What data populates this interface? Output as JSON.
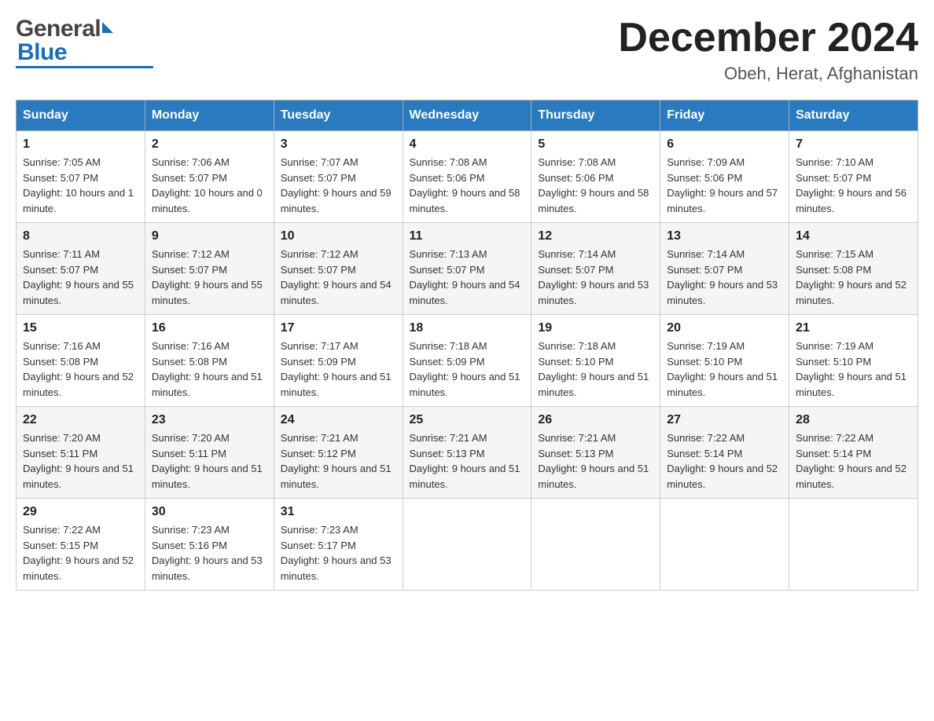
{
  "header": {
    "logo_general": "General",
    "logo_blue": "Blue",
    "month_title": "December 2024",
    "location": "Obeh, Herat, Afghanistan"
  },
  "calendar": {
    "days_of_week": [
      "Sunday",
      "Monday",
      "Tuesday",
      "Wednesday",
      "Thursday",
      "Friday",
      "Saturday"
    ],
    "weeks": [
      [
        {
          "day": "1",
          "sunrise": "7:05 AM",
          "sunset": "5:07 PM",
          "daylight": "10 hours and 1 minute."
        },
        {
          "day": "2",
          "sunrise": "7:06 AM",
          "sunset": "5:07 PM",
          "daylight": "10 hours and 0 minutes."
        },
        {
          "day": "3",
          "sunrise": "7:07 AM",
          "sunset": "5:07 PM",
          "daylight": "9 hours and 59 minutes."
        },
        {
          "day": "4",
          "sunrise": "7:08 AM",
          "sunset": "5:06 PM",
          "daylight": "9 hours and 58 minutes."
        },
        {
          "day": "5",
          "sunrise": "7:08 AM",
          "sunset": "5:06 PM",
          "daylight": "9 hours and 58 minutes."
        },
        {
          "day": "6",
          "sunrise": "7:09 AM",
          "sunset": "5:06 PM",
          "daylight": "9 hours and 57 minutes."
        },
        {
          "day": "7",
          "sunrise": "7:10 AM",
          "sunset": "5:07 PM",
          "daylight": "9 hours and 56 minutes."
        }
      ],
      [
        {
          "day": "8",
          "sunrise": "7:11 AM",
          "sunset": "5:07 PM",
          "daylight": "9 hours and 55 minutes."
        },
        {
          "day": "9",
          "sunrise": "7:12 AM",
          "sunset": "5:07 PM",
          "daylight": "9 hours and 55 minutes."
        },
        {
          "day": "10",
          "sunrise": "7:12 AM",
          "sunset": "5:07 PM",
          "daylight": "9 hours and 54 minutes."
        },
        {
          "day": "11",
          "sunrise": "7:13 AM",
          "sunset": "5:07 PM",
          "daylight": "9 hours and 54 minutes."
        },
        {
          "day": "12",
          "sunrise": "7:14 AM",
          "sunset": "5:07 PM",
          "daylight": "9 hours and 53 minutes."
        },
        {
          "day": "13",
          "sunrise": "7:14 AM",
          "sunset": "5:07 PM",
          "daylight": "9 hours and 53 minutes."
        },
        {
          "day": "14",
          "sunrise": "7:15 AM",
          "sunset": "5:08 PM",
          "daylight": "9 hours and 52 minutes."
        }
      ],
      [
        {
          "day": "15",
          "sunrise": "7:16 AM",
          "sunset": "5:08 PM",
          "daylight": "9 hours and 52 minutes."
        },
        {
          "day": "16",
          "sunrise": "7:16 AM",
          "sunset": "5:08 PM",
          "daylight": "9 hours and 51 minutes."
        },
        {
          "day": "17",
          "sunrise": "7:17 AM",
          "sunset": "5:09 PM",
          "daylight": "9 hours and 51 minutes."
        },
        {
          "day": "18",
          "sunrise": "7:18 AM",
          "sunset": "5:09 PM",
          "daylight": "9 hours and 51 minutes."
        },
        {
          "day": "19",
          "sunrise": "7:18 AM",
          "sunset": "5:10 PM",
          "daylight": "9 hours and 51 minutes."
        },
        {
          "day": "20",
          "sunrise": "7:19 AM",
          "sunset": "5:10 PM",
          "daylight": "9 hours and 51 minutes."
        },
        {
          "day": "21",
          "sunrise": "7:19 AM",
          "sunset": "5:10 PM",
          "daylight": "9 hours and 51 minutes."
        }
      ],
      [
        {
          "day": "22",
          "sunrise": "7:20 AM",
          "sunset": "5:11 PM",
          "daylight": "9 hours and 51 minutes."
        },
        {
          "day": "23",
          "sunrise": "7:20 AM",
          "sunset": "5:11 PM",
          "daylight": "9 hours and 51 minutes."
        },
        {
          "day": "24",
          "sunrise": "7:21 AM",
          "sunset": "5:12 PM",
          "daylight": "9 hours and 51 minutes."
        },
        {
          "day": "25",
          "sunrise": "7:21 AM",
          "sunset": "5:13 PM",
          "daylight": "9 hours and 51 minutes."
        },
        {
          "day": "26",
          "sunrise": "7:21 AM",
          "sunset": "5:13 PM",
          "daylight": "9 hours and 51 minutes."
        },
        {
          "day": "27",
          "sunrise": "7:22 AM",
          "sunset": "5:14 PM",
          "daylight": "9 hours and 52 minutes."
        },
        {
          "day": "28",
          "sunrise": "7:22 AM",
          "sunset": "5:14 PM",
          "daylight": "9 hours and 52 minutes."
        }
      ],
      [
        {
          "day": "29",
          "sunrise": "7:22 AM",
          "sunset": "5:15 PM",
          "daylight": "9 hours and 52 minutes."
        },
        {
          "day": "30",
          "sunrise": "7:23 AM",
          "sunset": "5:16 PM",
          "daylight": "9 hours and 53 minutes."
        },
        {
          "day": "31",
          "sunrise": "7:23 AM",
          "sunset": "5:17 PM",
          "daylight": "9 hours and 53 minutes."
        },
        null,
        null,
        null,
        null
      ]
    ]
  }
}
